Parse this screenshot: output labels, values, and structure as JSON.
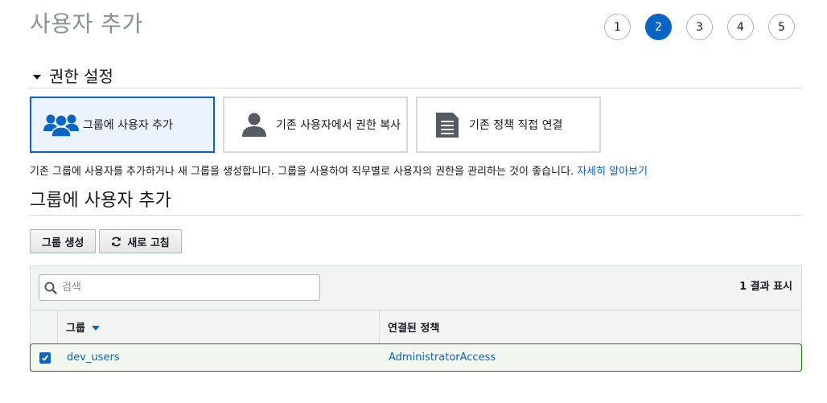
{
  "page": {
    "title": "사용자 추가"
  },
  "steps": {
    "items": [
      "1",
      "2",
      "3",
      "4",
      "5"
    ],
    "active_index": 1
  },
  "permissions_section": {
    "title": "권한 설정",
    "options": [
      {
        "label": "그룹에 사용자 추가",
        "icon": "users-group-icon",
        "selected": true
      },
      {
        "label": "기존 사용자에서 권한 복사",
        "icon": "user-icon",
        "selected": false
      },
      {
        "label": "기존 정책 직접 연결",
        "icon": "document-icon",
        "selected": false
      }
    ],
    "description": "기존 그룹에 사용자를 추가하거나 새 그룹을 생성합니다. 그룹을 사용하여 직무별로 사용자의 권한을 관리하는 것이 좋습니다.",
    "learn_more": "자세히 알아보기"
  },
  "group_section": {
    "title": "그룹에 사용자 추가",
    "create_group_label": "그룹 생성",
    "refresh_label": "새로 고침",
    "search_placeholder": "검색",
    "result_count": "1 결과 표시",
    "columns": {
      "group": "그룹",
      "policy": "연결된 정책"
    },
    "rows": [
      {
        "group": "dev_users",
        "policy": "AdministratorAccess",
        "checked": true
      }
    ]
  },
  "colors": {
    "accent": "#0a64c2",
    "selected_row_border": "#1d8102",
    "title_gray": "#879196"
  }
}
